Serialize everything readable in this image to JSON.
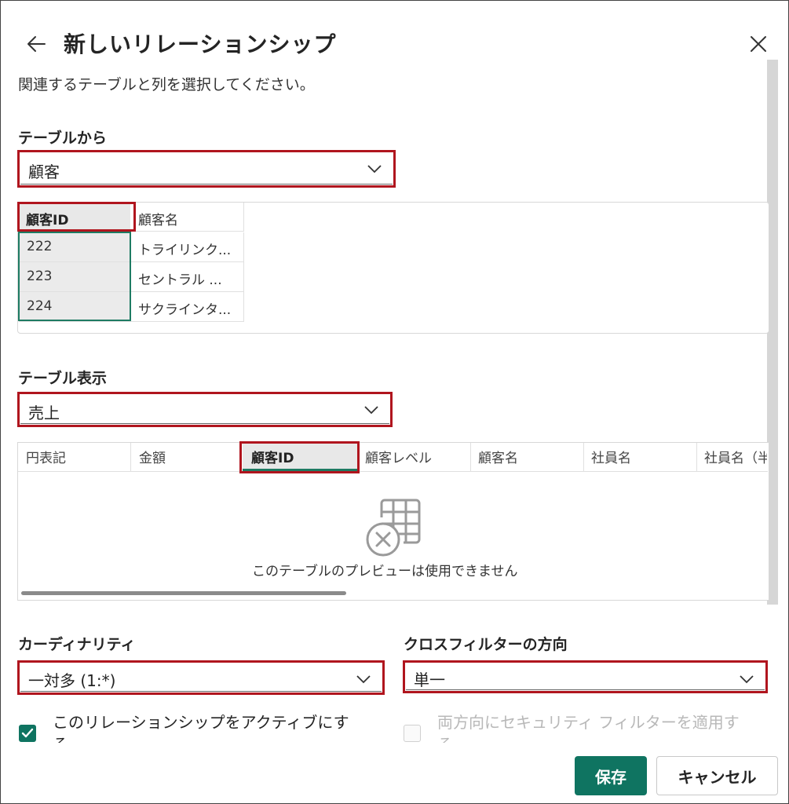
{
  "header": {
    "title": "新しいリレーションシップ",
    "subtitle": "関連するテーブルと列を選択してください。"
  },
  "from_table": {
    "label": "テーブルから",
    "selected": "顧客",
    "columns": [
      "顧客ID",
      "顧客名"
    ],
    "rows": [
      [
        "222",
        "トライリンク..."
      ],
      [
        "223",
        "セントラル ..."
      ],
      [
        "224",
        "サクラインタ..."
      ]
    ]
  },
  "to_table": {
    "label": "テーブル表示",
    "selected": "売上",
    "columns": [
      "円表記",
      "金額",
      "顧客ID",
      "顧客レベル",
      "顧客名",
      "社員名",
      "社員名（半"
    ],
    "empty_message": "このテーブルのプレビューは使用できません"
  },
  "cardinality": {
    "label": "カーディナリティ",
    "selected": "一対多 (1:*)"
  },
  "cross_filter": {
    "label": "クロスフィルターの方向",
    "selected": "単一"
  },
  "options": {
    "active_label_line1": "このリレーションシップをアクティブにす",
    "active_label_line2": "る",
    "security_label_line1": "両方向にセキュリティ フィルターを適用す",
    "security_label_line2": "る"
  },
  "footer": {
    "save_label": "保存",
    "cancel_label": "キャンセル"
  },
  "colors": {
    "accent": "#0f7461",
    "highlight_border": "#b0151e",
    "selected_column_border": "#1e7b63"
  }
}
